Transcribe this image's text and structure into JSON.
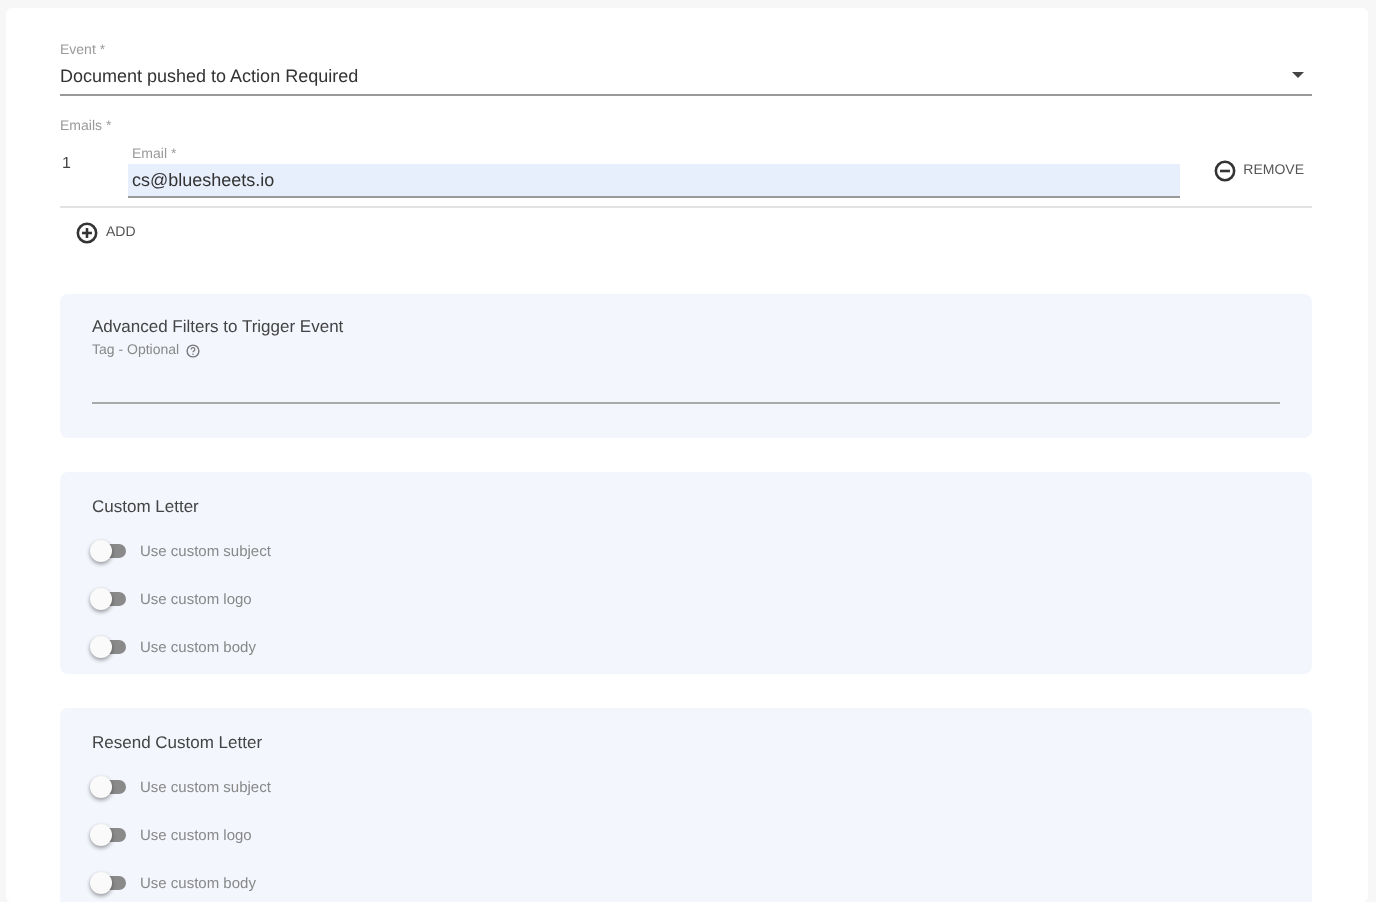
{
  "event": {
    "label": "Event *",
    "value": "Document pushed to Action Required"
  },
  "emails": {
    "label": "Emails *",
    "items": [
      {
        "index": "1",
        "label": "Email *",
        "value": "cs@bluesheets.io",
        "remove": "REMOVE"
      }
    ],
    "add": "ADD"
  },
  "filters": {
    "title": "Advanced Filters to Trigger Event",
    "tag_label": "Tag - Optional"
  },
  "letters": [
    {
      "title": "Custom Letter",
      "toggles": [
        {
          "label": "Use custom subject",
          "on": false
        },
        {
          "label": "Use custom logo",
          "on": false
        },
        {
          "label": "Use custom body",
          "on": false
        }
      ]
    },
    {
      "title": "Resend Custom Letter",
      "toggles": [
        {
          "label": "Use custom subject",
          "on": false
        },
        {
          "label": "Use custom logo",
          "on": false
        },
        {
          "label": "Use custom body",
          "on": false
        }
      ]
    }
  ]
}
